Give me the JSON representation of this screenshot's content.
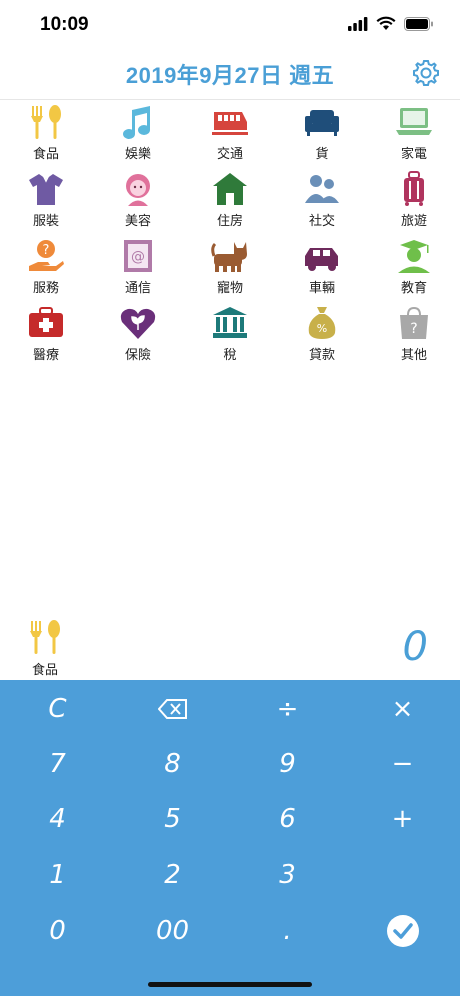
{
  "status": {
    "time": "10:09"
  },
  "header": {
    "date": "2019年9月27日 週五"
  },
  "categories": [
    {
      "label": "食品",
      "icon": "utensils-icon",
      "color": "#f2c744"
    },
    {
      "label": "娛樂",
      "icon": "music-note-icon",
      "color": "#5bb8dc"
    },
    {
      "label": "交通",
      "icon": "train-icon",
      "color": "#d6453d"
    },
    {
      "label": "貨",
      "icon": "sofa-icon",
      "color": "#1f4e7a"
    },
    {
      "label": "家電",
      "icon": "laptop-icon",
      "color": "#7cbf84"
    },
    {
      "label": "服裝",
      "icon": "shirt-icon",
      "color": "#6f5aa3"
    },
    {
      "label": "美容",
      "icon": "woman-face-icon",
      "color": "#e0719b"
    },
    {
      "label": "住房",
      "icon": "house-icon",
      "color": "#2f7a3a"
    },
    {
      "label": "社交",
      "icon": "people-icon",
      "color": "#6a8fb8"
    },
    {
      "label": "旅遊",
      "icon": "suitcase-icon",
      "color": "#b0345e"
    },
    {
      "label": "服務",
      "icon": "service-hand-icon",
      "color": "#ef8a3a"
    },
    {
      "label": "通信",
      "icon": "stamp-at-icon",
      "color": "#b07aa8"
    },
    {
      "label": "寵物",
      "icon": "cat-icon",
      "color": "#9a5b32"
    },
    {
      "label": "車輛",
      "icon": "car-icon",
      "color": "#6e2a5c"
    },
    {
      "label": "教育",
      "icon": "graduate-icon",
      "color": "#6fbf4a"
    },
    {
      "label": "醫療",
      "icon": "medical-kit-icon",
      "color": "#c52a2a"
    },
    {
      "label": "保險",
      "icon": "heart-leaf-icon",
      "color": "#6a2f7a"
    },
    {
      "label": "稅",
      "icon": "bank-icon",
      "color": "#1d7a7a"
    },
    {
      "label": "貸款",
      "icon": "money-bag-icon",
      "color": "#c8b04a"
    },
    {
      "label": "其他",
      "icon": "question-bag-icon",
      "color": "#a8a8a8"
    }
  ],
  "selected": {
    "label": "食品",
    "icon": "utensils-icon"
  },
  "amount": "0",
  "keypad": {
    "clear": "C",
    "backspace": "backspace-icon",
    "divide": "÷",
    "multiply": "×",
    "k7": "7",
    "k8": "8",
    "k9": "9",
    "minus": "−",
    "k4": "4",
    "k5": "5",
    "k6": "6",
    "plus": "+",
    "k1": "1",
    "k2": "2",
    "k3": "3",
    "k0": "0",
    "k00": "00",
    "dot": ".",
    "confirm": "check-icon"
  }
}
